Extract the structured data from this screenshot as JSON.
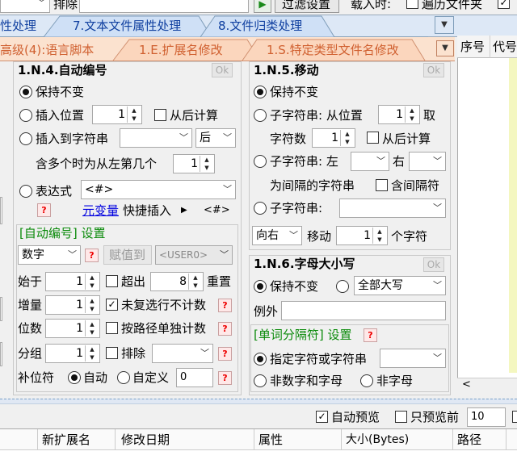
{
  "top_bar": {
    "sort_label": "排除",
    "filter_button": "过滤设置",
    "load_label": "载入时:",
    "traverse_label": "遍历文件夹"
  },
  "tabs_row1": [
    "性处理",
    "7.文本文件属性处理",
    "8.文件归类处理"
  ],
  "tabs_row2": [
    "高级(4):语言脚本",
    "1.E.扩展名修改",
    "1.S.特定类型文件名修改"
  ],
  "panel_auto_number": {
    "title": "1.N.4.自动编号",
    "ok": "Ok",
    "keep": "保持不变",
    "insert_pos": "插入位置",
    "insert_pos_value": "1",
    "calc_from_right": "从后计算",
    "insert_to_str": "插入到字符串",
    "after_option": "后",
    "multi_contain": "含多个时为从左第几个",
    "multi_value": "1",
    "expression": "表达式",
    "expression_value": "<#>",
    "meta_var": "元变量",
    "quick_insert": "快捷插入",
    "quick_tag": "<#>",
    "settings_title": "[自动编号] 设置",
    "type_value": "数字",
    "assign_to": "赋值到",
    "assign_target": "<USER0>",
    "start_label": "始于",
    "start_value": "1",
    "exceed_label": "超出",
    "exceed_value": "8",
    "reset_label": "重置",
    "inc_label": "增量",
    "inc_value": "1",
    "not_counted": "未复选行不计数",
    "digits_label": "位数",
    "digits_value": "1",
    "by_path": "按路径单独计数",
    "group_label": "分组",
    "group_value": "1",
    "exclude_label": "排除",
    "pad_label": "补位符",
    "auto_label": "自动",
    "custom_label": "自定义",
    "custom_value": "0"
  },
  "panel_move": {
    "title": "1.N.5.移动",
    "ok": "Ok",
    "keep": "保持不变",
    "substr_from": "子字符串: 从位置",
    "from_value": "1",
    "take": "取",
    "count_label": "字符数",
    "count_value": "1",
    "calc_from_right": "从后计算",
    "substr_left": "子字符串: 左",
    "right_label": "右",
    "between": "为间隔的字符串",
    "include_sep": "含间隔符",
    "substr_colon": "子字符串:",
    "direction": "向右",
    "move_label": "移动",
    "move_value": "1",
    "chars_label": "个字符"
  },
  "panel_case": {
    "title": "1.N.6.字母大小写",
    "ok": "Ok",
    "keep": "保持不变",
    "all_upper": "全部大写",
    "exception": "例外",
    "sep_title": "[单词分隔符] 设置",
    "specified": "指定字符或字符串",
    "non_alnum": "非数字和字母",
    "non_char": "非字母"
  },
  "right_grid": {
    "col1": "序号",
    "col2": "代号"
  },
  "status_bar": {
    "auto_preview": "自动预览",
    "only_preview": "只预览前",
    "preview_count": "10"
  },
  "file_table": {
    "columns": [
      "新扩展名",
      "修改日期",
      "属性",
      "大小(Bytes)",
      "路径"
    ]
  }
}
